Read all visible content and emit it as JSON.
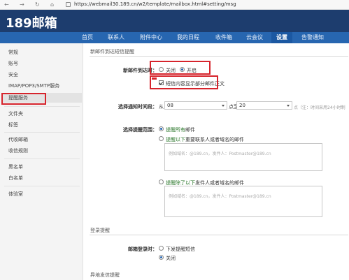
{
  "browser": {
    "url": "https://webmail30.189.cn/w2/template/mailbox.html#setting/msg",
    "back": "←",
    "forward": "→",
    "reload": "↻",
    "home": "⌂"
  },
  "logo": "189邮箱",
  "nav": [
    "首页",
    "联系人",
    "附件中心",
    "我的日程",
    "收件箱",
    "云会议",
    "设置",
    "告警通知"
  ],
  "sidebar": {
    "items": [
      "常规",
      "账号",
      "安全",
      "IMAP/POP3/SMTP服务",
      "提醒服务",
      "文件夹",
      "标签",
      "代收邮箱",
      "收信规则",
      "黑名单",
      "白名单",
      "体验室"
    ]
  },
  "section1": {
    "title": "新邮件到达短信提醒",
    "arrival_label": "新邮件到达时：",
    "off": "关闭",
    "on": "开启",
    "sms_preview": "短信内容显示部分邮件正文",
    "time_label": "选择通知时间段：",
    "from": "从",
    "from_value": "08",
    "to_point": "点至",
    "to_value": "20",
    "note": "点（注：时间采用24小时制"
  },
  "section2": {
    "range_label": "选择提醒范围：",
    "opt_all_hl": "提醒所有",
    "opt_all_rest": "邮件",
    "opt_only_hl": "提醒以下",
    "opt_only_rest": "重要联系人或者域名的邮件",
    "placeholder": "例如域名：@189.cn，发件人：Postmaster@189.cn",
    "opt_except_hl": "提醒除了以下",
    "opt_except_rest": "发件人或者域名的邮件"
  },
  "section3": {
    "title": "登录提醒",
    "label": "邮箱登录时：",
    "opt_send": "下发提醒短信",
    "opt_off": "关闭"
  },
  "section4": {
    "title": "异地发信提醒"
  },
  "colors": {
    "header_dark": "#1d3d6e",
    "nav_blue": "#2766b0",
    "highlight_red": "#d6242c",
    "green_text": "#2f7a2f"
  }
}
